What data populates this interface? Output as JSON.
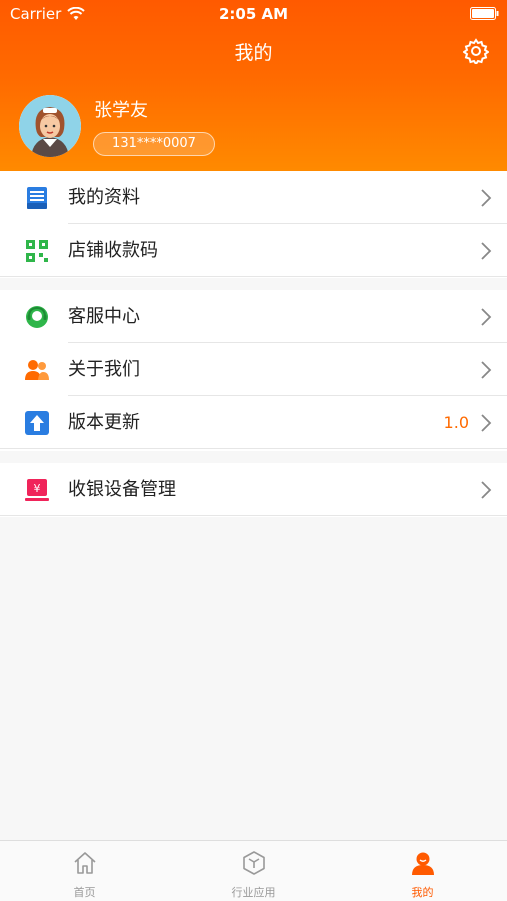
{
  "status_bar": {
    "carrier": "Carrier",
    "time": "2:05 AM"
  },
  "nav": {
    "title": "我的",
    "settings_icon": "gear-icon"
  },
  "profile": {
    "name": "张学友",
    "phone": "131****0007",
    "avatar_icon": "avatar"
  },
  "menu_groups": [
    {
      "items": [
        {
          "label": "我的资料",
          "icon": "profile-card-icon",
          "color": "#2a7de1"
        },
        {
          "label": "店铺收款码",
          "icon": "qr-code-icon",
          "color": "#2fb64a"
        }
      ]
    },
    {
      "items": [
        {
          "label": "客服中心",
          "icon": "customer-service-icon",
          "color": "#2fb64a"
        },
        {
          "label": "关于我们",
          "icon": "people-icon",
          "color": "#ff6a00"
        },
        {
          "label": "版本更新",
          "icon": "upload-arrow-icon",
          "color": "#2a7de1",
          "value": "1.0"
        }
      ]
    },
    {
      "items": [
        {
          "label": "收银设备管理",
          "icon": "cash-register-icon",
          "color": "#f0245a"
        }
      ]
    }
  ],
  "tabbar": {
    "tabs": [
      {
        "label": "首页",
        "icon": "home-icon"
      },
      {
        "label": "行业应用",
        "icon": "cube-icon"
      },
      {
        "label": "我的",
        "icon": "user-icon",
        "active": true
      }
    ]
  },
  "colors": {
    "accent": "#ff5a00",
    "header_gradient_end": "#ff8a00",
    "background": "#f7f7f7"
  }
}
